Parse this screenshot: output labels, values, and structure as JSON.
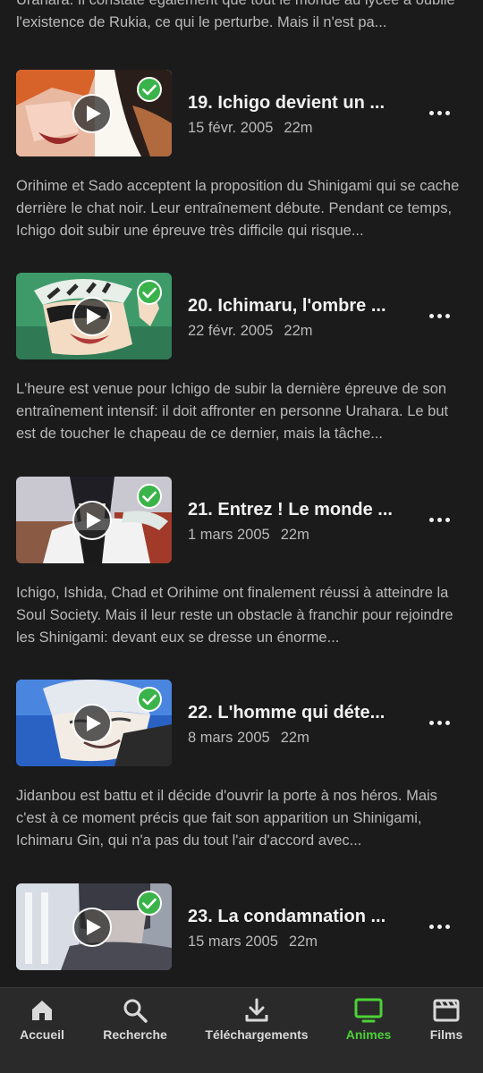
{
  "partial_description": "Urahara. Il constate également que tout le monde au lycée a oublié l'existence de Rukia, ce qui le perturbe. Mais il n'est pa...",
  "episodes": [
    {
      "title": "19. Ichigo devient un ...",
      "date": "15 févr. 2005",
      "duration": "22m",
      "description": "Orihime et Sado acceptent la proposition du Shinigami qui se cache derrière le chat noir. Leur entraînement débute. Pendant ce temps, Ichigo doit subir une épreuve très difficile qui risque..."
    },
    {
      "title": "20. Ichimaru, l'ombre ...",
      "date": "22 févr. 2005",
      "duration": "22m",
      "description": "L'heure est venue pour Ichigo de subir la dernière épreuve de son entraînement intensif: il doit affronter en personne Urahara. Le but est de toucher le chapeau de ce dernier, mais la tâche..."
    },
    {
      "title": "21. Entrez ! Le monde ...",
      "date": "1 mars 2005",
      "duration": "22m",
      "description": "Ichigo, Ishida, Chad et Orihime ont finalement réussi à atteindre la Soul Society. Mais il leur reste un obstacle à franchir pour rejoindre les Shinigami: devant eux se dresse un énorme..."
    },
    {
      "title": "22. L'homme qui déte...",
      "date": "8 mars 2005",
      "duration": "22m",
      "description": "Jidanbou est battu et il décide d'ouvrir la porte à nos héros. Mais c'est à ce moment précis que fait son apparition un Shinigami, Ichimaru Gin, qui n'a pas du tout l'air d'accord avec..."
    },
    {
      "title": "23. La condamnation ...",
      "date": "15 mars 2005",
      "duration": "22m",
      "description": ""
    }
  ],
  "icons": {
    "play": "play-icon",
    "watched": "check-circle-icon",
    "more": "more-horizontal-icon"
  },
  "colors": {
    "background": "#1b1b1b",
    "tabbar": "#2a2a2a",
    "accent": "#4cd137",
    "watched": "#3ab44a"
  },
  "tabs": [
    {
      "label": "Accueil",
      "icon": "home-icon",
      "active": false
    },
    {
      "label": "Recherche",
      "icon": "search-icon",
      "active": false
    },
    {
      "label": "Téléchargements",
      "icon": "download-icon",
      "active": false
    },
    {
      "label": "Animes",
      "icon": "tv-icon",
      "active": true
    },
    {
      "label": "Films",
      "icon": "film-icon",
      "active": false
    }
  ]
}
